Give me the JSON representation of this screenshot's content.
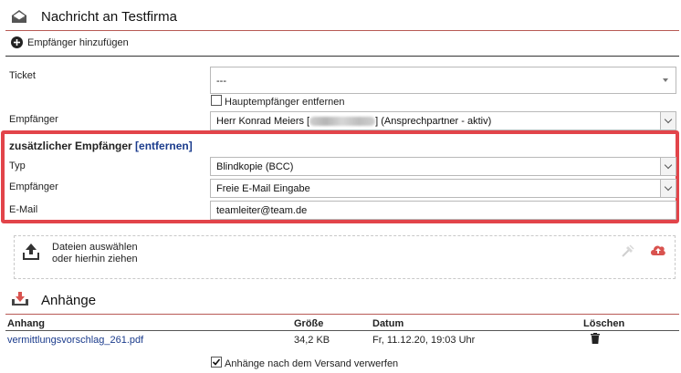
{
  "header": {
    "title": "Nachricht an Testfirma",
    "icon": "envelope-icon"
  },
  "add_recipient": {
    "label": "Empfänger hinzufügen",
    "icon": "plus-circle-icon"
  },
  "form": {
    "ticket_label": "Ticket",
    "ticket_value": "---",
    "remove_main_label": "Hauptempfänger entfernen",
    "recipient_label": "Empfänger",
    "recipient_name": "Herr Konrad Meiers [",
    "recipient_suffix": "] (Ansprechpartner - aktiv)"
  },
  "extra": {
    "heading": "zusätzlicher Empfänger",
    "remove_link": "[entfernen]",
    "type_label": "Typ",
    "type_value": "Blindkopie (BCC)",
    "recipient_label": "Empfänger",
    "recipient_value": "Freie E-Mail Eingabe",
    "email_label": "E-Mail",
    "email_value": "teamleiter@team.de"
  },
  "upload": {
    "line1": "Dateien auswählen",
    "line2": "oder hierhin ziehen",
    "accent": "#d9534f"
  },
  "attachments": {
    "title": "Anhänge",
    "columns": {
      "name": "Anhang",
      "size": "Größe",
      "date": "Datum",
      "delete": "Löschen"
    },
    "rows": [
      {
        "name": "vermittlungsvorschlag_261.pdf",
        "size": "34,2 KB",
        "date": "Fr, 11.12.20, 19:03 Uhr"
      }
    ],
    "discard_label": "Anhänge nach dem Versand verwerfen",
    "discard_checked": true
  },
  "colors": {
    "highlight": "#e2444a",
    "link": "#1a3b8c",
    "divider": "#b85a55"
  }
}
